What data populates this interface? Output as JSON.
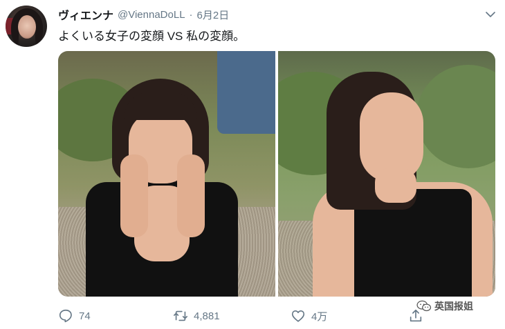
{
  "tweet": {
    "display_name": "ヴィエンナ",
    "handle": "@ViennaDoLL",
    "separator": "·",
    "date": "6月2日",
    "text": "よくいる女子の変顔 VS 私の変顔。"
  },
  "actions": {
    "reply_count": "74",
    "retweet_count": "4,881",
    "like_count": "4万"
  },
  "watermark": {
    "text": "英国报姐"
  },
  "colors": {
    "text_primary": "#14171a",
    "text_secondary": "#657786",
    "background": "#ffffff"
  },
  "icons": [
    "more-icon",
    "reply-icon",
    "retweet-icon",
    "like-icon",
    "share-icon",
    "wechat-icon"
  ]
}
